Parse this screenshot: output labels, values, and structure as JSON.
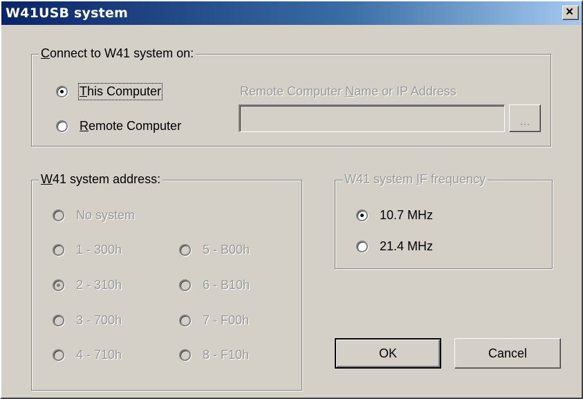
{
  "window": {
    "title": "W41USB system",
    "close_label": "×"
  },
  "connect_group": {
    "legend_mnemonic": "C",
    "legend_rest": "onnect to W41 system on:",
    "this_computer": {
      "mnemonic": "T",
      "rest": "his Computer",
      "checked": true
    },
    "remote_computer": {
      "mnemonic": "R",
      "rest": "emote Computer",
      "checked": false
    },
    "remote_label_pre": "Remote Computer ",
    "remote_label_mnemonic": "N",
    "remote_label_post": "ame or IP Address",
    "remote_value": "",
    "browse_label": "..."
  },
  "address_group": {
    "legend_mnemonic": "W",
    "legend_rest": "41 system address:",
    "options": [
      {
        "label": "No system",
        "checked": false
      },
      {
        "label": "1 - 300h",
        "checked": false
      },
      {
        "label": "5 - B00h",
        "checked": false
      },
      {
        "label": "2 - 310h",
        "checked": true
      },
      {
        "label": "6 - B10h",
        "checked": false
      },
      {
        "label": "3 - 700h",
        "checked": false
      },
      {
        "label": "7 - F00h",
        "checked": false
      },
      {
        "label": "4 - 710h",
        "checked": false
      },
      {
        "label": "8 - F10h",
        "checked": false
      }
    ]
  },
  "if_group": {
    "legend_pre": "W41 system ",
    "legend_mnemonic": "I",
    "legend_post": "F frequency",
    "options": [
      {
        "label": "10.7 MHz",
        "checked": true
      },
      {
        "label": "21.4 MHz",
        "checked": false
      }
    ]
  },
  "buttons": {
    "ok": "OK",
    "cancel": "Cancel"
  }
}
